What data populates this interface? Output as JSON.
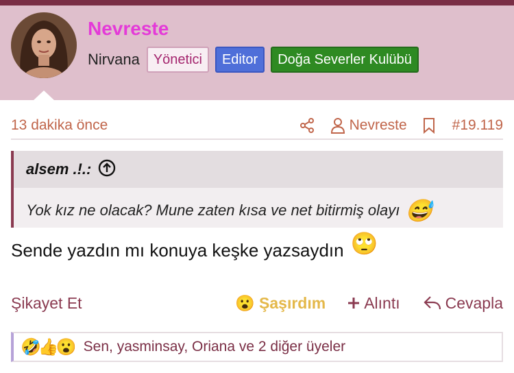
{
  "header": {
    "username": "Nevreste",
    "user_title": "Nirvana",
    "badges": [
      "Yönetici",
      "Editor",
      "Doğa Severler Kulübü"
    ]
  },
  "post": {
    "time": "13 dakika önce",
    "author": "Nevreste",
    "number": "#19.119",
    "quote": {
      "author": "alsem .!.:",
      "text": "Yok kız ne olacak? Mune zaten kısa ve net bitirmiş olayı",
      "emoji": "😅"
    },
    "message": "Sende yazdın mı konuya keşke yazsaydın",
    "message_emoji": "🙄"
  },
  "actions": {
    "report": "Şikayet Et",
    "reaction_emoji": "😮",
    "reaction": "Şaşırdım",
    "quote": "Alıntı",
    "reply": "Cevapla"
  },
  "reactions": {
    "icons": [
      "🤣",
      "👍",
      "😮"
    ],
    "text": "Sen, yasminsay, Oriana ve 2 diğer üyeler"
  },
  "colors": {
    "accent": "#7a2e45",
    "header_bg": "#dfbfcc",
    "username": "#e43ad8",
    "meta_text": "#c0654a"
  }
}
